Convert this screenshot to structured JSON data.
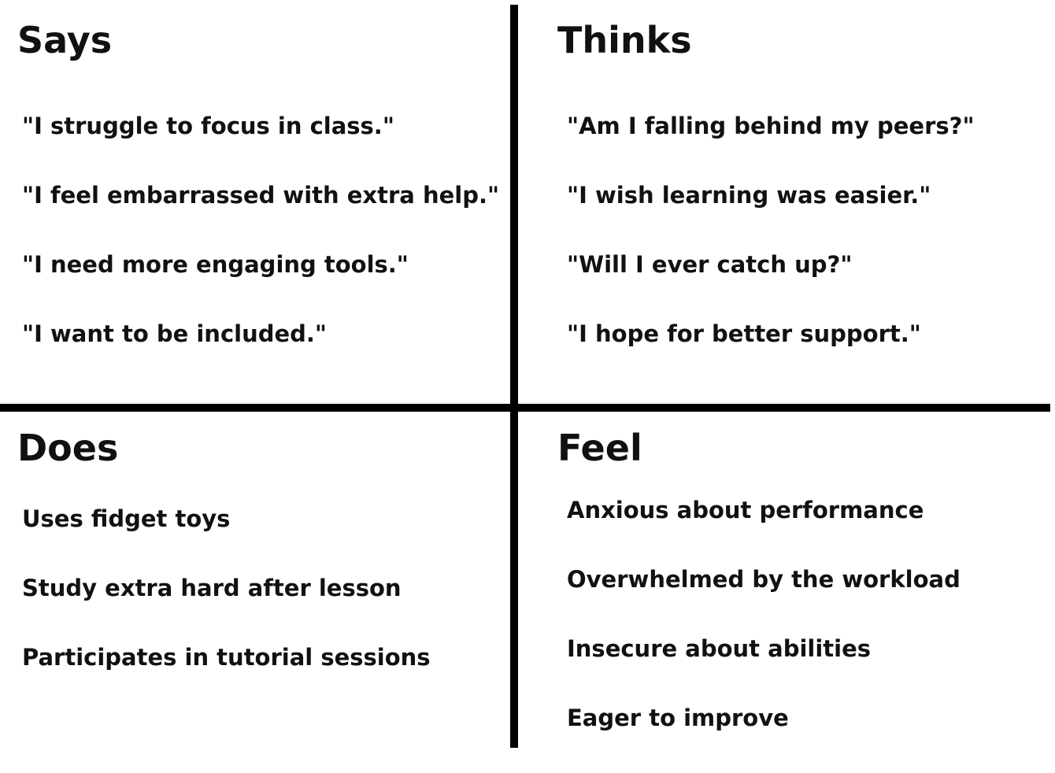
{
  "quadrants": {
    "says": {
      "title": "Says",
      "items": [
        "\"I struggle to focus in class.\"",
        "\"I feel embarrassed with extra help.\"",
        "\"I need more engaging tools.\"",
        "\"I want to be included.\""
      ]
    },
    "thinks": {
      "title": "Thinks",
      "items": [
        "\"Am I falling behind my peers?\"",
        "\"I wish learning was easier.\"",
        "\"Will I ever catch up?\"",
        "\"I hope for better support.\""
      ]
    },
    "does": {
      "title": "Does",
      "items": [
        "Uses fidget toys",
        "Study extra hard after lesson",
        "Participates in tutorial sessions"
      ]
    },
    "feel": {
      "title": "Feel",
      "items": [
        "Anxious about performance",
        "Overwhelmed by the workload",
        "Insecure about abilities",
        "Eager to improve"
      ]
    }
  }
}
